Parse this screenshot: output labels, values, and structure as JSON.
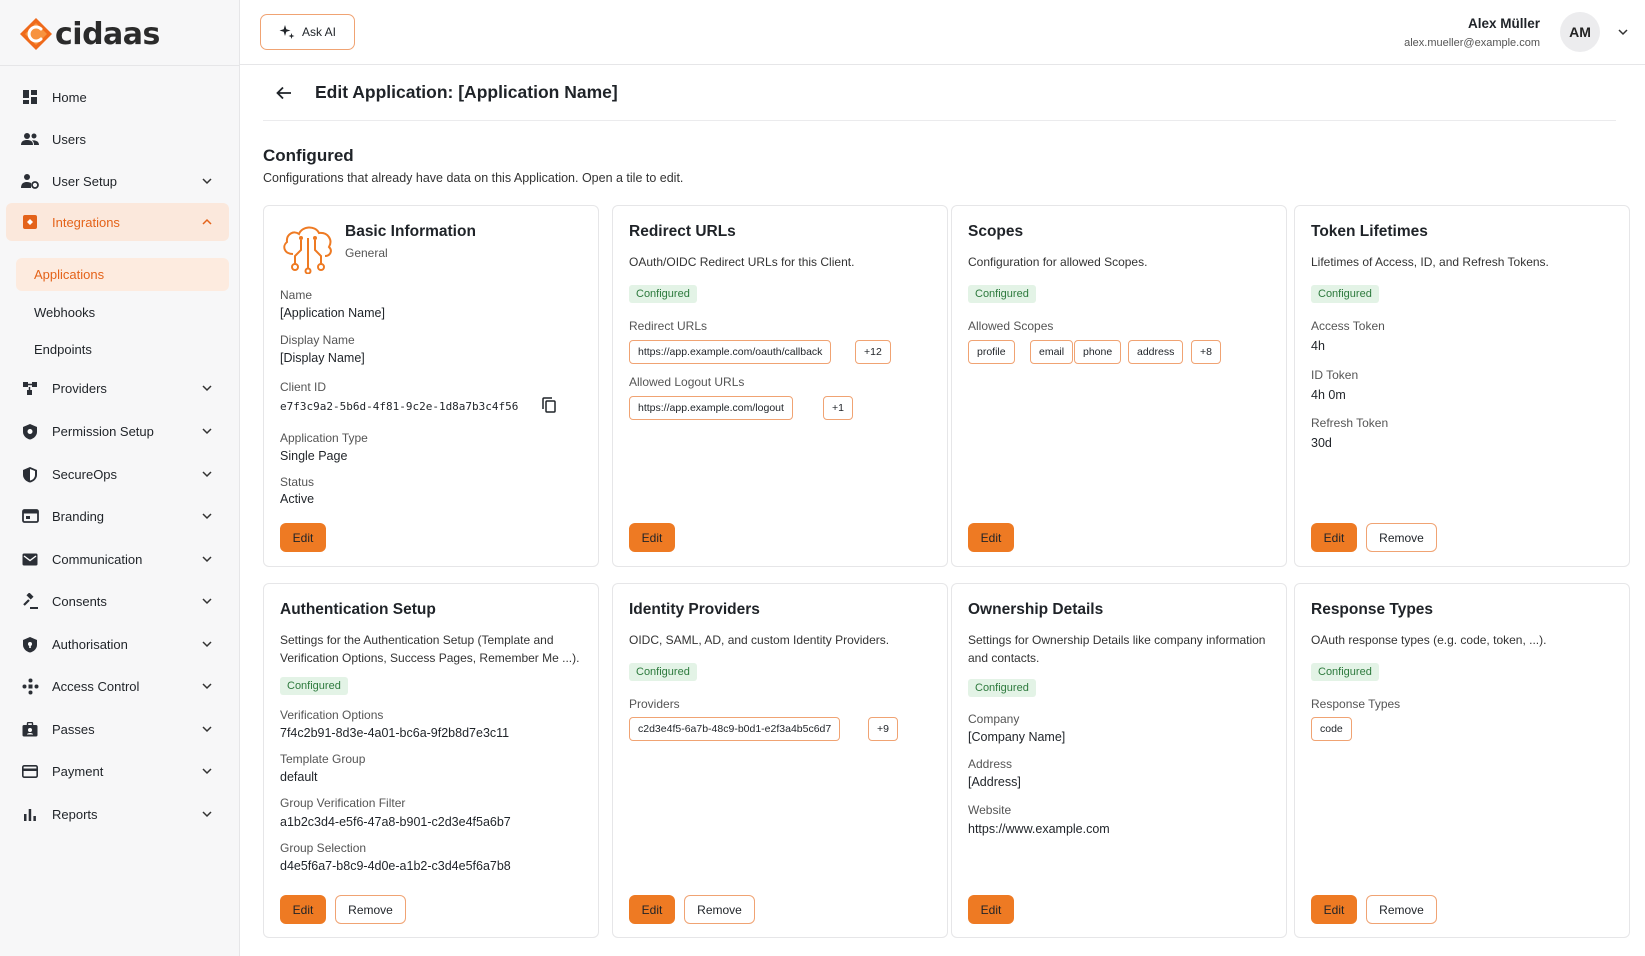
{
  "app": {
    "logo_text": "cidaas"
  },
  "topbar": {
    "ask_ai_label": "Ask AI",
    "user_name": "Alex Müller",
    "user_email": "alex.mueller@example.com",
    "avatar_initials": "AM"
  },
  "sidebar": {
    "items": [
      {
        "label": "Home",
        "icon": "grid-icon"
      },
      {
        "label": "Users",
        "icon": "users-icon"
      },
      {
        "label": "User Setup",
        "icon": "user-settings-icon"
      },
      {
        "label": "Integrations",
        "icon": "integrations-icon",
        "active": true
      },
      {
        "label": "Providers",
        "icon": "providers-icon"
      },
      {
        "label": "Permission Setup",
        "icon": "shield-icon"
      },
      {
        "label": "SecureOps",
        "icon": "shield-check-icon"
      },
      {
        "label": "Branding",
        "icon": "branding-icon"
      },
      {
        "label": "Communication",
        "icon": "mail-icon"
      },
      {
        "label": "Consents",
        "icon": "gavel-icon"
      },
      {
        "label": "Authorisation",
        "icon": "shield-lock-icon"
      },
      {
        "label": "Access Control",
        "icon": "access-icon"
      },
      {
        "label": "Passes",
        "icon": "pass-icon"
      },
      {
        "label": "Payment",
        "icon": "card-icon"
      },
      {
        "label": "Reports",
        "icon": "bar-chart-icon"
      }
    ],
    "sub_items": [
      {
        "label": "Applications",
        "active": true
      },
      {
        "label": "Webhooks"
      },
      {
        "label": "Endpoints"
      }
    ]
  },
  "page": {
    "title": "Edit Application: [Application Name]",
    "section_title": "Configured",
    "section_subtitle": "Configurations that already have data on this Application. Open a tile to edit."
  },
  "common": {
    "edit": "Edit",
    "remove": "Remove",
    "configured": "Configured"
  },
  "cards": {
    "basic": {
      "title": "Basic Information",
      "subtitle": "General",
      "name_label": "Name",
      "name_value": "[Application Name]",
      "display_label": "Display Name",
      "display_value": "[Display Name]",
      "client_label": "Client ID",
      "client_value": "e7f3c9a2-5b6d-4f81-9c2e-1d8a7b3c4f56",
      "type_label": "Application Type",
      "type_value": "Single Page",
      "status_label": "Status",
      "status_value": "Active"
    },
    "redirect": {
      "title": "Redirect URLs",
      "desc": "OAuth/OIDC Redirect URLs for this Client.",
      "redirect_label": "Redirect URLs",
      "redirect_url": "https://app.example.com/oauth/callback",
      "redirect_more": "+12",
      "logout_label": "Allowed Logout URLs",
      "logout_url": "https://app.example.com/logout",
      "logout_more": "+1"
    },
    "scopes": {
      "title": "Scopes",
      "desc": "Configuration for allowed Scopes.",
      "allowed_label": "Allowed Scopes",
      "scopes": [
        "profile",
        "email",
        "phone",
        "address"
      ],
      "more": "+8"
    },
    "token": {
      "title": "Token Lifetimes",
      "desc": "Lifetimes of Access, ID, and Refresh Tokens.",
      "access_label": "Access Token",
      "access_value": "4h",
      "id_label": "ID Token",
      "id_value": "4h 0m",
      "refresh_label": "Refresh Token",
      "refresh_value": "30d"
    },
    "auth": {
      "title": "Authentication Setup",
      "desc": "Settings for the Authentication Setup (Template and Verification Options, Success Pages, Remember Me ...).",
      "verif_label": "Verification Options",
      "verif_value": "7f4c2b91-8d3e-4a01-bc6a-9f2b8d7e3c11",
      "template_label": "Template Group",
      "template_value": "default",
      "gvf_label": "Group Verification Filter",
      "gvf_value": "a1b2c3d4-e5f6-47a8-b901-c2d3e4f5a6b7",
      "gs_label": "Group Selection",
      "gs_value": "d4e5f6a7-b8c9-4d0e-a1b2-c3d4e5f6a7b8"
    },
    "idp": {
      "title": "Identity Providers",
      "desc": "OIDC, SAML, AD, and custom Identity Providers.",
      "providers_label": "Providers",
      "provider_value": "c2d3e4f5-6a7b-48c9-b0d1-e2f3a4b5c6d7",
      "more": "+9"
    },
    "owner": {
      "title": "Ownership Details",
      "desc": "Settings for Ownership Details like company information and contacts.",
      "company_label": "Company",
      "company_value": "[Company Name]",
      "address_label": "Address",
      "address_value": "[Address]",
      "website_label": "Website",
      "website_value": "https://www.example.com"
    },
    "response": {
      "title": "Response Types",
      "desc": "OAuth response types (e.g. code, token, ...).",
      "types_label": "Response Types",
      "type_value": "code"
    }
  },
  "colors": {
    "accent": "#ee7a23",
    "accent_light": "#fbe8dc",
    "badge_bg": "#e3f3e6",
    "badge_text": "#2d7a3d"
  }
}
